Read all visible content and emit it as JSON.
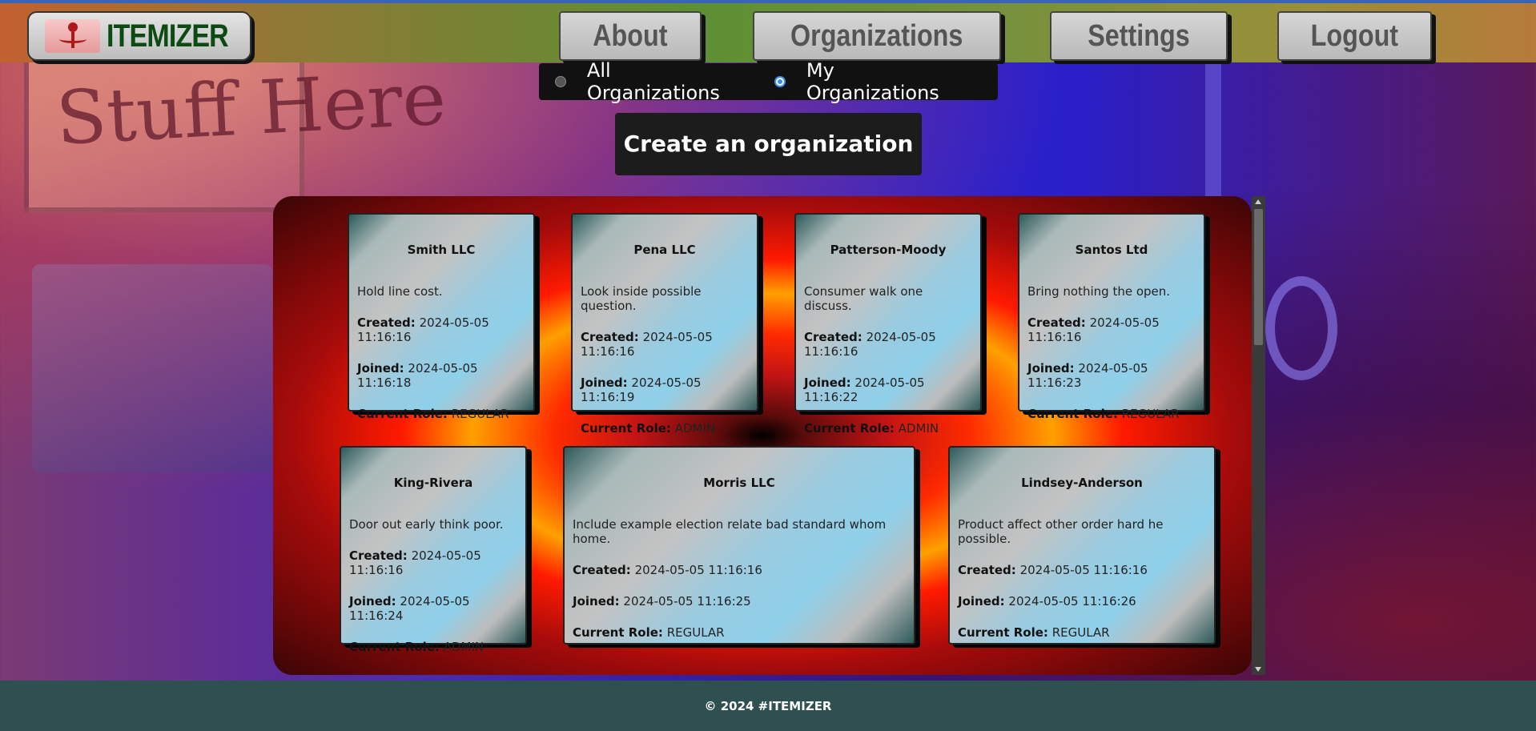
{
  "header": {
    "logo_text": "ITEMIZER",
    "nav": [
      "About",
      "Organizations",
      "Settings",
      "Logout"
    ]
  },
  "filter": {
    "options": [
      "All Organizations",
      "My Organizations"
    ],
    "selected": "My Organizations"
  },
  "create_button": "Create an organization",
  "labels": {
    "created": "Created:",
    "joined": "Joined:",
    "role": "Current Role:"
  },
  "organizations": [
    {
      "name": "Smith LLC",
      "description": "Hold line cost.",
      "created": "2024-05-05 11:16:16",
      "joined": "2024-05-05 11:16:18",
      "role": "REGULAR"
    },
    {
      "name": "Pena LLC",
      "description": "Look inside possible question.",
      "created": "2024-05-05 11:16:16",
      "joined": "2024-05-05 11:16:19",
      "role": "ADMIN"
    },
    {
      "name": "Patterson-Moody",
      "description": "Consumer walk one discuss.",
      "created": "2024-05-05 11:16:16",
      "joined": "2024-05-05 11:16:22",
      "role": "ADMIN"
    },
    {
      "name": "Santos Ltd",
      "description": "Bring nothing the open.",
      "created": "2024-05-05 11:16:16",
      "joined": "2024-05-05 11:16:23",
      "role": "REGULAR"
    },
    {
      "name": "King-Rivera",
      "description": "Door out early think poor.",
      "created": "2024-05-05 11:16:16",
      "joined": "2024-05-05 11:16:24",
      "role": "ADMIN"
    },
    {
      "name": "Morris LLC",
      "description": "Include example election relate bad standard whom home.",
      "created": "2024-05-05 11:16:16",
      "joined": "2024-05-05 11:16:25",
      "role": "REGULAR"
    },
    {
      "name": "Lindsey-Anderson",
      "description": "Product affect other order hard he possible.",
      "created": "2024-05-05 11:16:16",
      "joined": "2024-05-05 11:16:26",
      "role": "REGULAR"
    }
  ],
  "background_sign_text": "Stuff Here",
  "footer": "© 2024 #ITEMIZER",
  "colors": {
    "footer_bg": "#2f5050",
    "create_bg": "#1c1c1c",
    "radio_accent": "#3b8ef0"
  }
}
